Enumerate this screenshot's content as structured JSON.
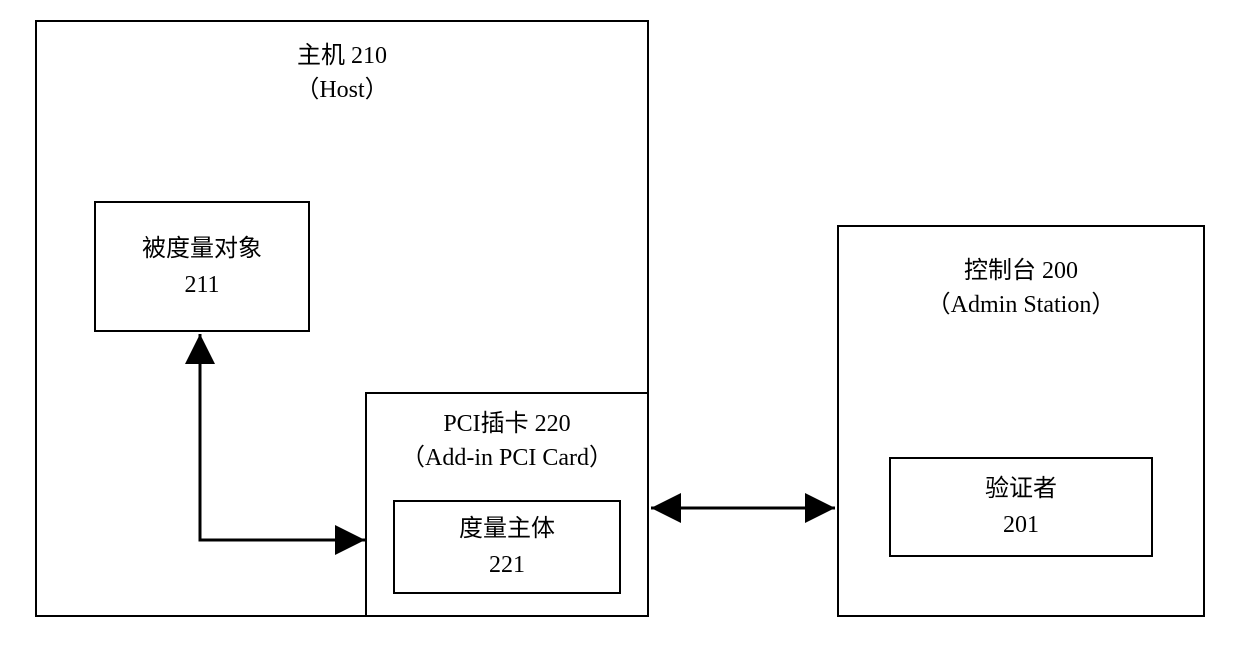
{
  "host": {
    "title_line1": "主机 210",
    "title_line2": "（Host）",
    "measured_object": {
      "line1": "被度量对象",
      "line2": "211"
    },
    "pci_card": {
      "title_line1": "PCI插卡 220",
      "title_line2": "（Add-in PCI Card）",
      "measurement_subject": {
        "line1": "度量主体",
        "line2": "221"
      }
    }
  },
  "console": {
    "title_line1": "控制台 200",
    "title_line2": "（Admin Station）",
    "verifier": {
      "line1": "验证者",
      "line2": "201"
    }
  }
}
